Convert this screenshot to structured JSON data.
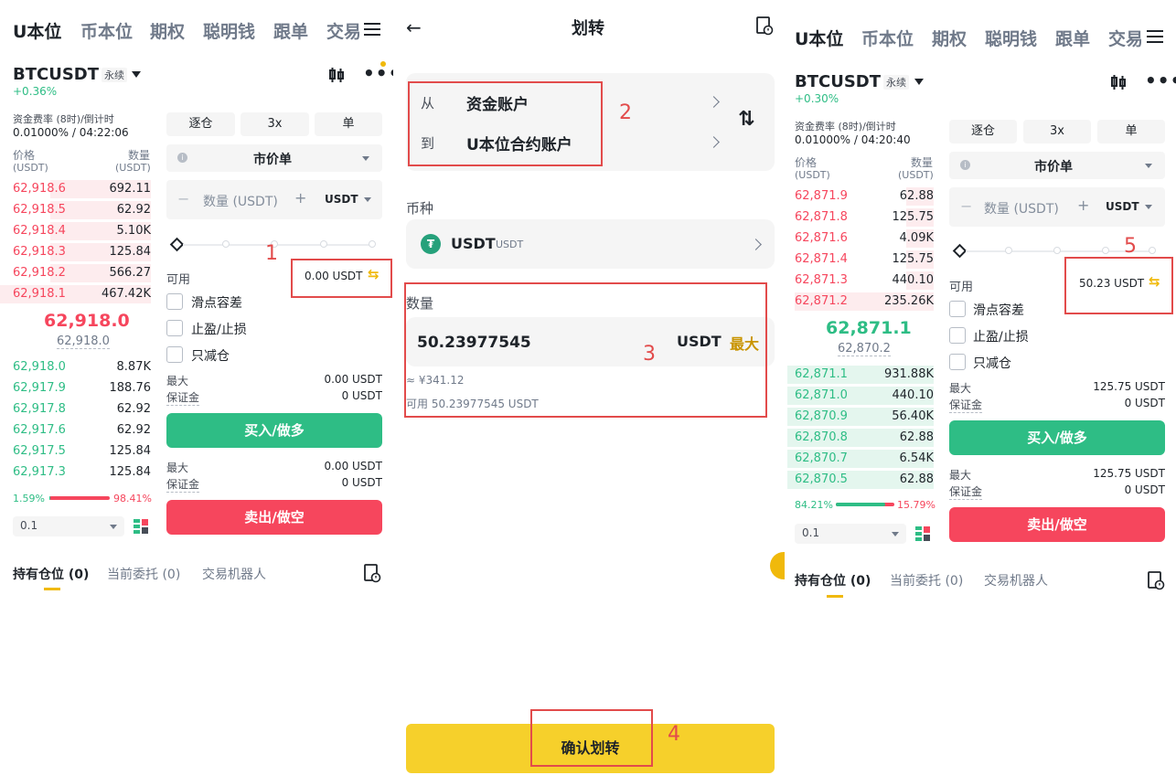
{
  "left": {
    "tabs": [
      "U本位",
      "币本位",
      "期权",
      "聪明钱",
      "跟单",
      "交易"
    ],
    "symbol": "BTCUSDT",
    "perp": "永续",
    "change": "+0.36%",
    "funding_label": "资金费率 (8时)/倒计时",
    "funding_value": "0.01000% / 04:22:06",
    "price_label": "价格",
    "price_unit": "(USDT)",
    "qty_label": "数量",
    "qty_unit": "(USDT)",
    "asks": [
      {
        "price": "62,918.6",
        "qty": "692.11"
      },
      {
        "price": "62,918.5",
        "qty": "62.92"
      },
      {
        "price": "62,918.4",
        "qty": "5.10K"
      },
      {
        "price": "62,918.3",
        "qty": "125.84"
      },
      {
        "price": "62,918.2",
        "qty": "566.27"
      },
      {
        "price": "62,918.1",
        "qty": "467.42K"
      }
    ],
    "last_price": "62,918.0",
    "mark_price": "62,918.0",
    "bids": [
      {
        "price": "62,918.0",
        "qty": "8.87K"
      },
      {
        "price": "62,917.9",
        "qty": "188.76"
      },
      {
        "price": "62,917.8",
        "qty": "62.92"
      },
      {
        "price": "62,917.6",
        "qty": "62.92"
      },
      {
        "price": "62,917.5",
        "qty": "125.84"
      },
      {
        "price": "62,917.3",
        "qty": "125.84"
      }
    ],
    "ratio_buy": "1.59%",
    "ratio_sell": "98.41%",
    "ratio_buy_fraction": 0.0159,
    "depth_select": "0.1",
    "margin_mode": "逐仓",
    "leverage": "3x",
    "position_mode": "单",
    "order_type": "市价单",
    "qty_placeholder": "数量 (USDT)",
    "qty_unit_select": "USDT",
    "available_label": "可用",
    "available_value": "0.00 USDT",
    "slippage": "滑点容差",
    "tpsl": "止盈/止损",
    "reduce_only": "只减仓",
    "max_label": "最大",
    "margin_label": "保证金",
    "buy_max": "0.00 USDT",
    "buy_margin": "0 USDT",
    "buy_btn": "买入/做多",
    "sell_max": "0.00 USDT",
    "sell_margin": "0 USDT",
    "sell_btn": "卖出/做空",
    "positions_tab": "持有仓位 (0)",
    "orders_tab": "当前委托 (0)",
    "bots_tab": "交易机器人",
    "annot": "1"
  },
  "middle": {
    "title": "划转",
    "from_label": "从",
    "from_value": "资金账户",
    "to_label": "到",
    "to_value": "U本位合约账户",
    "coin_label": "币种",
    "coin_name": "USDT",
    "coin_sub": "USDT",
    "amount_label": "数量",
    "amount_value": "50.23977545",
    "amount_unit": "USDT",
    "max_btn": "最大",
    "approx": "≈ ¥341.12",
    "available": "可用 50.23977545 USDT",
    "confirm_btn": "确认划转",
    "annot2": "2",
    "annot3": "3",
    "annot4": "4"
  },
  "right": {
    "tabs": [
      "U本位",
      "币本位",
      "期权",
      "聪明钱",
      "跟单",
      "交易"
    ],
    "symbol": "BTCUSDT",
    "perp": "永续",
    "change": "+0.30%",
    "funding_label": "资金费率 (8时)/倒计时",
    "funding_value": "0.01000% / 04:20:40",
    "price_label": "价格",
    "price_unit": "(USDT)",
    "qty_label": "数量",
    "qty_unit": "(USDT)",
    "asks": [
      {
        "price": "62,871.9",
        "qty": "62.88"
      },
      {
        "price": "62,871.8",
        "qty": "125.75"
      },
      {
        "price": "62,871.6",
        "qty": "4.09K"
      },
      {
        "price": "62,871.4",
        "qty": "125.75"
      },
      {
        "price": "62,871.3",
        "qty": "440.10"
      },
      {
        "price": "62,871.2",
        "qty": "235.26K"
      }
    ],
    "last_price": "62,871.1",
    "mark_price": "62,870.2",
    "bids": [
      {
        "price": "62,871.1",
        "qty": "931.88K"
      },
      {
        "price": "62,871.0",
        "qty": "440.10"
      },
      {
        "price": "62,870.9",
        "qty": "56.40K"
      },
      {
        "price": "62,870.8",
        "qty": "62.88"
      },
      {
        "price": "62,870.7",
        "qty": "6.54K"
      },
      {
        "price": "62,870.5",
        "qty": "62.88"
      }
    ],
    "ratio_buy": "84.21%",
    "ratio_sell": "15.79%",
    "ratio_buy_fraction": 0.8421,
    "depth_select": "0.1",
    "margin_mode": "逐仓",
    "leverage": "3x",
    "position_mode": "单",
    "order_type": "市价单",
    "qty_placeholder": "数量 (USDT)",
    "qty_unit_select": "USDT",
    "available_label": "可用",
    "available_value": "50.23 USDT",
    "slippage": "滑点容差",
    "tpsl": "止盈/止损",
    "reduce_only": "只减仓",
    "max_label": "最大",
    "margin_label": "保证金",
    "buy_max": "125.75 USDT",
    "buy_margin": "0 USDT",
    "buy_btn": "买入/做多",
    "sell_max": "125.75 USDT",
    "sell_margin": "0 USDT",
    "sell_btn": "卖出/做空",
    "positions_tab": "持有仓位 (0)",
    "orders_tab": "当前委托 (0)",
    "bots_tab": "交易机器人",
    "annot": "5"
  },
  "colors": {
    "green": "#2ebd85",
    "red": "#f6465d",
    "yellow": "#f6d02b",
    "annotation": "#e24b4b"
  }
}
